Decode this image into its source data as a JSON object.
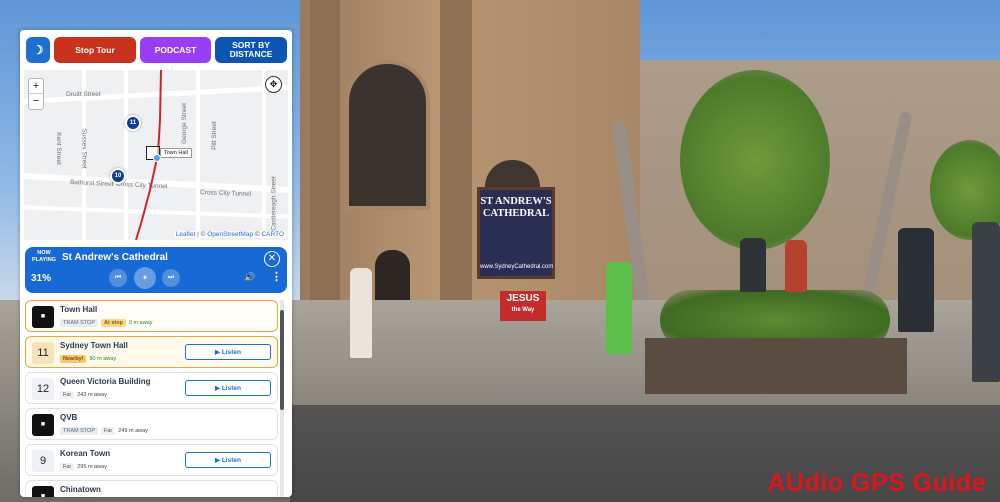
{
  "colors": {
    "accent_blue": "#1769d6",
    "stop_red": "#c9321c",
    "podcast_purple": "#9a3ef5",
    "sort_navy": "#0d55b3",
    "watermark_red": "#e0141b"
  },
  "scene": {
    "sign": {
      "title": "ST ANDREW'S CATHEDRAL",
      "url": "www.SydneyCathedral.com"
    },
    "banner": {
      "title": "JESUS",
      "subtitle": "the Way"
    },
    "watermark": "AUdio  GPS Guide"
  },
  "toolbar": {
    "theme_icon": "moon-icon",
    "stop_label": "Stop Tour",
    "podcast_label": "PODCAST",
    "sort_label": "SORT BY DISTANCE"
  },
  "map": {
    "zoom_in": "+",
    "zoom_out": "−",
    "streets": {
      "druitt": "Druitt Street",
      "bathurst": "Bathurst Street",
      "cross_city": "Cross City Tunnel",
      "cross_city_2": "Cross City Tunnel",
      "kent": "Kent Street",
      "sussex": "Sussex Street",
      "george": "George Street",
      "pitt": "Pitt Street",
      "castlereagh": "Castlereagh Street"
    },
    "markers": [
      "11",
      "10"
    ],
    "tooltip": "Town Hall",
    "attribution": {
      "leaflet": "Leaflet",
      "sep": " | © ",
      "osm": "OpenStreetMap",
      "sep2": " © ",
      "carto": "CARTO"
    }
  },
  "now_playing": {
    "label": "NOW PLAYING",
    "title": "St Andrew's Cathedral",
    "progress": "31%",
    "prev_icon": "⏮",
    "play_icon": "⏸",
    "next_icon": "⏭",
    "volume_icon": "🔊",
    "more_icon": "⋮",
    "close_icon": "✕"
  },
  "stops": [
    {
      "badge": "■",
      "badge_type": "tram",
      "name": "Town Hall",
      "tag": "TRAM STOP",
      "status": "At stop",
      "status_type": "atstop",
      "distance": "9 m away",
      "state": "at-stop",
      "listen": ""
    },
    {
      "badge": "11",
      "badge_type": "num-near",
      "name": "Sydney Town Hall",
      "tag": "",
      "status": "Nearby!",
      "status_type": "near",
      "distance": "80 m away",
      "state": "nearby",
      "listen": "▶ Listen"
    },
    {
      "badge": "12",
      "badge_type": "num",
      "name": "Queen Victoria Building",
      "tag": "",
      "status": "Far",
      "status_type": "far",
      "distance": "243 m away",
      "state": "far",
      "listen": "▶ Listen"
    },
    {
      "badge": "■",
      "badge_type": "tram",
      "name": "QVB",
      "tag": "TRAM STOP",
      "status": "Far",
      "status_type": "far",
      "distance": "249 m away",
      "state": "far",
      "listen": ""
    },
    {
      "badge": "9",
      "badge_type": "num",
      "name": "Korean Town",
      "tag": "",
      "status": "Far",
      "status_type": "far",
      "distance": "295 m away",
      "state": "far",
      "listen": "▶ Listen"
    },
    {
      "badge": "■",
      "badge_type": "tram",
      "name": "Chinatown",
      "tag": "",
      "status": "",
      "status_type": "far",
      "distance": "",
      "state": "far",
      "listen": ""
    }
  ]
}
